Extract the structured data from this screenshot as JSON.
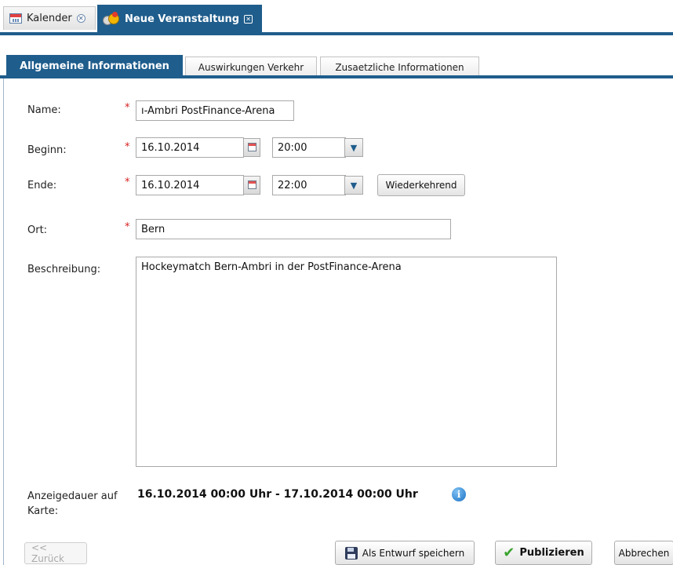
{
  "doc_tabs": [
    {
      "label": "Kalender",
      "icon": "calendar-icon"
    },
    {
      "label": "Neue Veranstaltung",
      "icon": "event-icon"
    }
  ],
  "sub_tabs": [
    {
      "label": "Allgemeine Informationen"
    },
    {
      "label": "Auswirkungen Verkehr"
    },
    {
      "label": "Zusaetzliche Informationen"
    }
  ],
  "form": {
    "required_mark": "*",
    "name": {
      "label": "Name:",
      "value": "ı-Ambri PostFinance-Arena"
    },
    "beginn": {
      "label": "Beginn:",
      "date": "16.10.2014",
      "time": "20:00"
    },
    "ende": {
      "label": "Ende:",
      "date": "16.10.2014",
      "time": "22:00",
      "recurring_button": "Wiederkehrend"
    },
    "ort": {
      "label": "Ort:",
      "value": "Bern"
    },
    "beschreibung": {
      "label": "Beschreibung:",
      "value": "Hockeymatch Bern-Ambri in der PostFinance-Arena"
    },
    "anzeigedauer": {
      "label_line1": "Anzeigedauer auf",
      "label_line2": "Karte:",
      "value": "16.10.2014 00:00 Uhr - 17.10.2014 00:00 Uhr"
    }
  },
  "buttons": {
    "back": "<< Zurück",
    "save_draft": "Als Entwurf speichern",
    "publish": "Publizieren",
    "cancel": "Abbrechen"
  },
  "colors": {
    "accent": "#1f5d8c",
    "required": "#d62020",
    "publish_check": "#3aa32f"
  }
}
